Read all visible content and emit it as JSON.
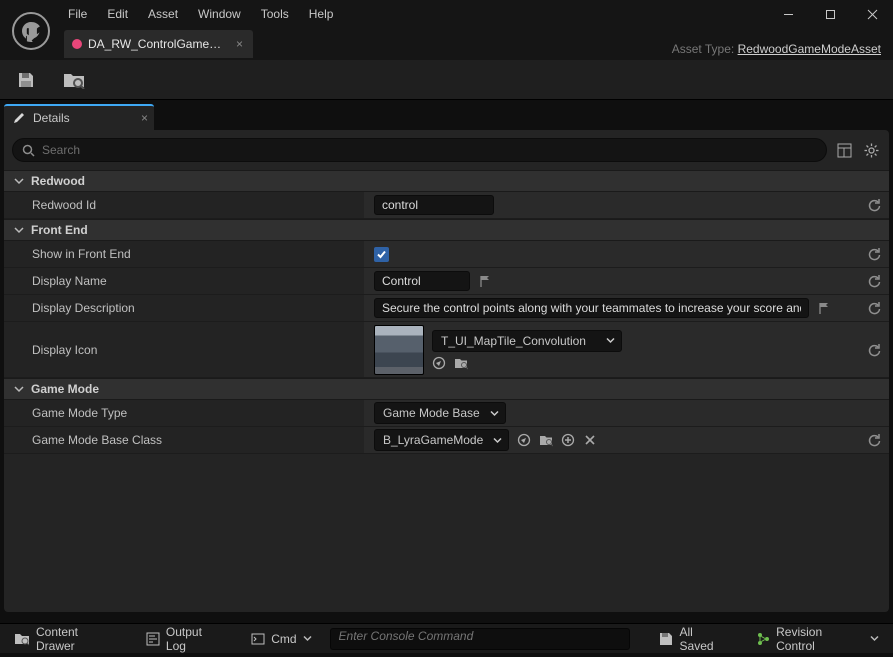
{
  "menus": {
    "file": "File",
    "edit": "Edit",
    "asset": "Asset",
    "window": "Window",
    "tools": "Tools",
    "help": "Help"
  },
  "tab": {
    "title": "DA_RW_ControlGameM…"
  },
  "asset_type": {
    "label": "Asset Type:",
    "link": "RedwoodGameModeAsset"
  },
  "details": {
    "panel_title": "Details",
    "search_placeholder": "Search",
    "categories": {
      "redwood": {
        "title": "Redwood",
        "redwood_id": {
          "label": "Redwood Id",
          "value": "control"
        }
      },
      "front_end": {
        "title": "Front End",
        "show": {
          "label": "Show in Front End",
          "checked": true
        },
        "name": {
          "label": "Display Name",
          "value": "Control"
        },
        "desc": {
          "label": "Display Description",
          "value": "Secure the control points along with your teammates to increase your score and win."
        },
        "icon": {
          "label": "Display Icon",
          "asset": "T_UI_MapTile_Convolution"
        }
      },
      "game_mode": {
        "title": "Game Mode",
        "type": {
          "label": "Game Mode Type",
          "value": "Game Mode Base"
        },
        "base": {
          "label": "Game Mode Base Class",
          "value": "B_LyraGameMode"
        }
      }
    }
  },
  "statusbar": {
    "content_drawer": "Content Drawer",
    "output_log": "Output Log",
    "cmd": "Cmd",
    "console_placeholder": "Enter Console Command",
    "all_saved": "All Saved",
    "revision": "Revision Control"
  }
}
